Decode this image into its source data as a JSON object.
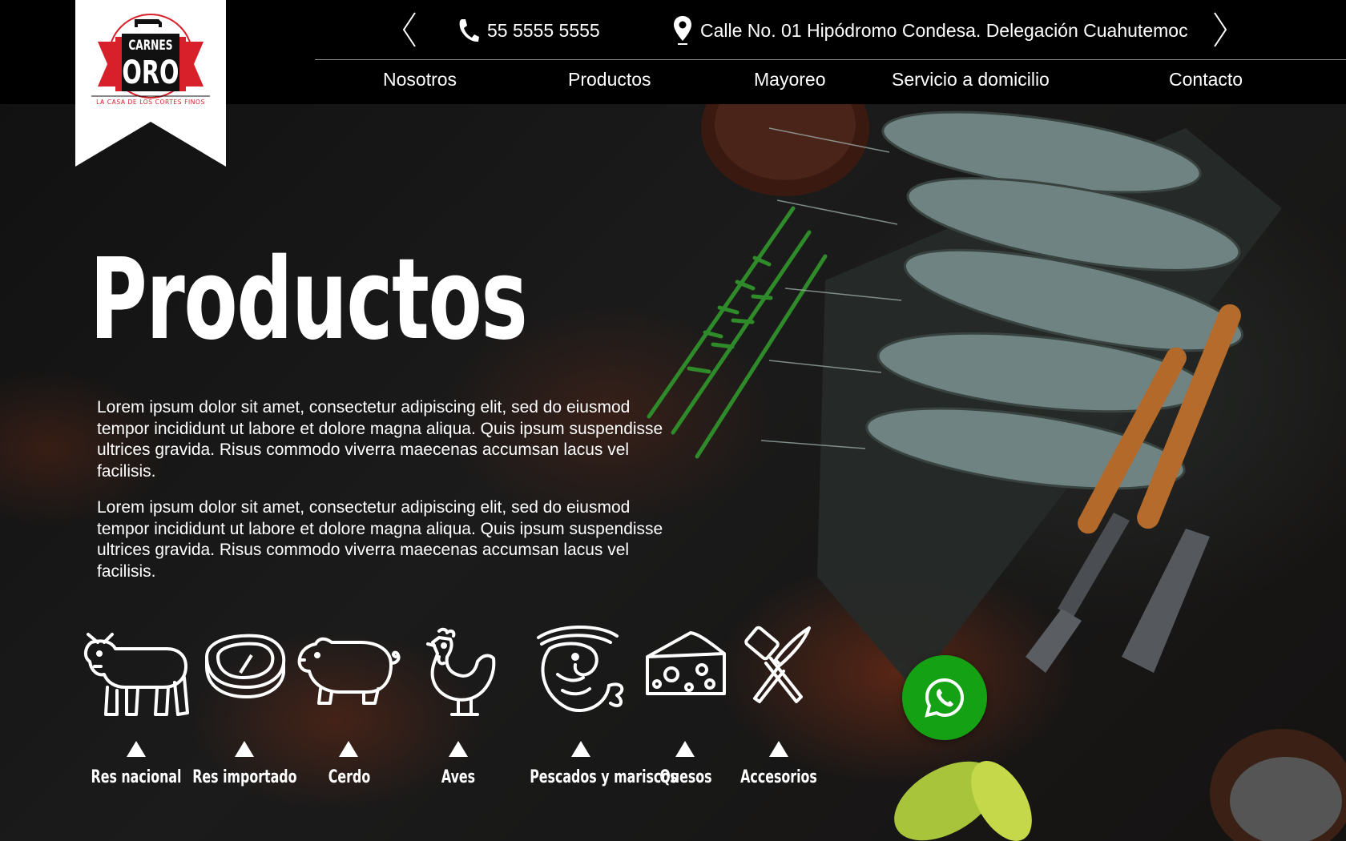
{
  "colors": {
    "accent_red": "#d8202a",
    "whatsapp_green": "#14a214",
    "header_bg": "#000000",
    "text": "#ffffff"
  },
  "logo": {
    "line1": "CARNES",
    "line2": "ORO",
    "tagline": "LA CASA DE LOS CORTES FINOS"
  },
  "header": {
    "phone": "55 5555 5555",
    "address": "Calle No. 01 Hipódromo Condesa. Delegación Cuahutemoc",
    "prev_icon": "chevron-left-icon",
    "next_icon": "chevron-right-icon"
  },
  "nav": [
    {
      "label": "Nosotros"
    },
    {
      "label": "Productos"
    },
    {
      "label": "Mayoreo"
    },
    {
      "label": "Servicio a domicilio"
    },
    {
      "label": "Contacto"
    }
  ],
  "hero": {
    "title": "Productos",
    "paragraphs": [
      "Lorem ipsum dolor sit amet, consectetur adipiscing elit, sed do eiusmod tempor incididunt ut labore et dolore magna aliqua. Quis ipsum suspendisse ultrices gravida. Risus commodo viverra maecenas accumsan lacus vel facilisis.",
      "Lorem ipsum dolor sit amet, consectetur adipiscing elit, sed do eiusmod tempor incididunt ut labore et dolore magna aliqua. Quis ipsum suspendisse ultrices gravida. Risus commodo viverra maecenas accumsan lacus vel facilisis."
    ]
  },
  "categories": [
    {
      "label": "Res nacional",
      "icon": "cow-icon"
    },
    {
      "label": "Res importado",
      "icon": "steak-icon"
    },
    {
      "label": "Cerdo",
      "icon": "pig-icon"
    },
    {
      "label": "Aves",
      "icon": "chicken-icon"
    },
    {
      "label": "Pescados y mariscos",
      "icon": "shrimp-icon"
    },
    {
      "label": "Quesos",
      "icon": "cheese-icon"
    },
    {
      "label": "Accesorios",
      "icon": "utensils-icon"
    }
  ],
  "whatsapp": {
    "icon": "whatsapp-icon"
  }
}
